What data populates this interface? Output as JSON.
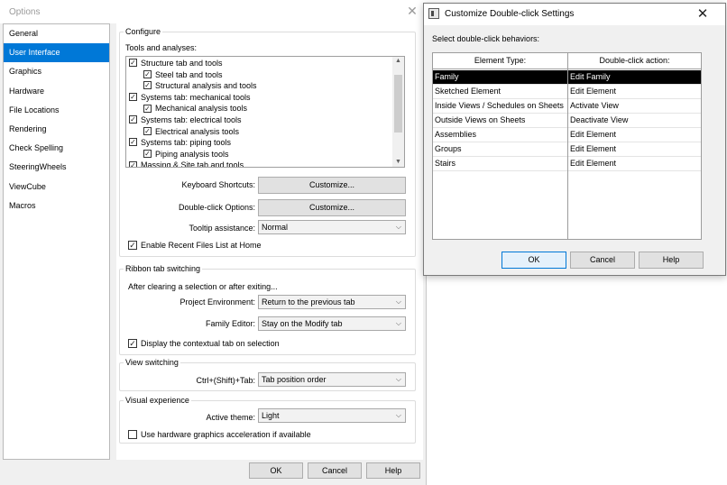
{
  "options_window": {
    "title": "Options",
    "sidebar": {
      "items": [
        "General",
        "User Interface",
        "Graphics",
        "Hardware",
        "File Locations",
        "Rendering",
        "Check Spelling",
        "SteeringWheels",
        "ViewCube",
        "Macros"
      ],
      "selected": "User Interface"
    },
    "configure": {
      "legend": "Configure",
      "tools_label": "Tools and analyses:",
      "tree": [
        {
          "label": "Structure tab and tools",
          "checked": true,
          "indent": 0
        },
        {
          "label": "Steel tab and tools",
          "checked": true,
          "indent": 1
        },
        {
          "label": "Structural analysis and tools",
          "checked": true,
          "indent": 1
        },
        {
          "label": "Systems tab: mechanical tools",
          "checked": true,
          "indent": 0
        },
        {
          "label": "Mechanical analysis tools",
          "checked": true,
          "indent": 1
        },
        {
          "label": "Systems tab: electrical tools",
          "checked": true,
          "indent": 0
        },
        {
          "label": "Electrical analysis tools",
          "checked": true,
          "indent": 1
        },
        {
          "label": "Systems tab: piping tools",
          "checked": true,
          "indent": 0
        },
        {
          "label": "Piping analysis tools",
          "checked": true,
          "indent": 1
        },
        {
          "label": "Massing & Site tab and tools",
          "checked": true,
          "indent": 0
        }
      ],
      "keyboard_label": "Keyboard Shortcuts:",
      "customize_label": "Customize...",
      "doubleclick_label": "Double-click Options:",
      "tooltip_label": "Tooltip assistance:",
      "tooltip_value": "Normal",
      "recent_files_label": "Enable Recent Files List at Home",
      "recent_files_checked": true
    },
    "ribbon": {
      "legend": "Ribbon tab switching",
      "after_label": "After clearing a selection or after exiting...",
      "project_env_label": "Project Environment:",
      "project_env_value": "Return to the previous tab",
      "family_editor_label": "Family Editor:",
      "family_editor_value": "Stay on the Modify tab",
      "contextual_label": "Display the contextual tab on selection",
      "contextual_checked": true
    },
    "view_switching": {
      "legend": "View switching",
      "ctrl_label": "Ctrl+(Shift)+Tab:",
      "ctrl_value": "Tab position order"
    },
    "visual": {
      "legend": "Visual experience",
      "theme_label": "Active theme:",
      "theme_value": "Light",
      "hw_label": "Use hardware graphics acceleration if available",
      "hw_checked": false
    },
    "footer": {
      "ok": "OK",
      "cancel": "Cancel",
      "help": "Help"
    }
  },
  "dialog": {
    "title": "Customize Double-click Settings",
    "instruction": "Select double-click behaviors:",
    "columns": [
      "Element Type:",
      "Double-click action:"
    ],
    "rows": [
      {
        "type": "Family",
        "action": "Edit Family",
        "selected": true
      },
      {
        "type": "Sketched Element",
        "action": "Edit Element"
      },
      {
        "type": "Inside Views / Schedules on Sheets",
        "action": "Activate View"
      },
      {
        "type": "Outside Views on Sheets",
        "action": "Deactivate View"
      },
      {
        "type": "Assemblies",
        "action": "Edit Element"
      },
      {
        "type": "Groups",
        "action": "Edit Element"
      },
      {
        "type": "Stairs",
        "action": "Edit Element"
      }
    ],
    "buttons": {
      "ok": "OK",
      "cancel": "Cancel",
      "help": "Help"
    }
  },
  "colors": {
    "selection_blue": "#0078d7",
    "selected_row": "#000000",
    "dialog_bg": "#f0f0f0"
  },
  "icons": {
    "close": "close-icon",
    "checkbox": "checkbox-icon",
    "dropdown": "chevron-down-icon",
    "app": "app-icon"
  }
}
